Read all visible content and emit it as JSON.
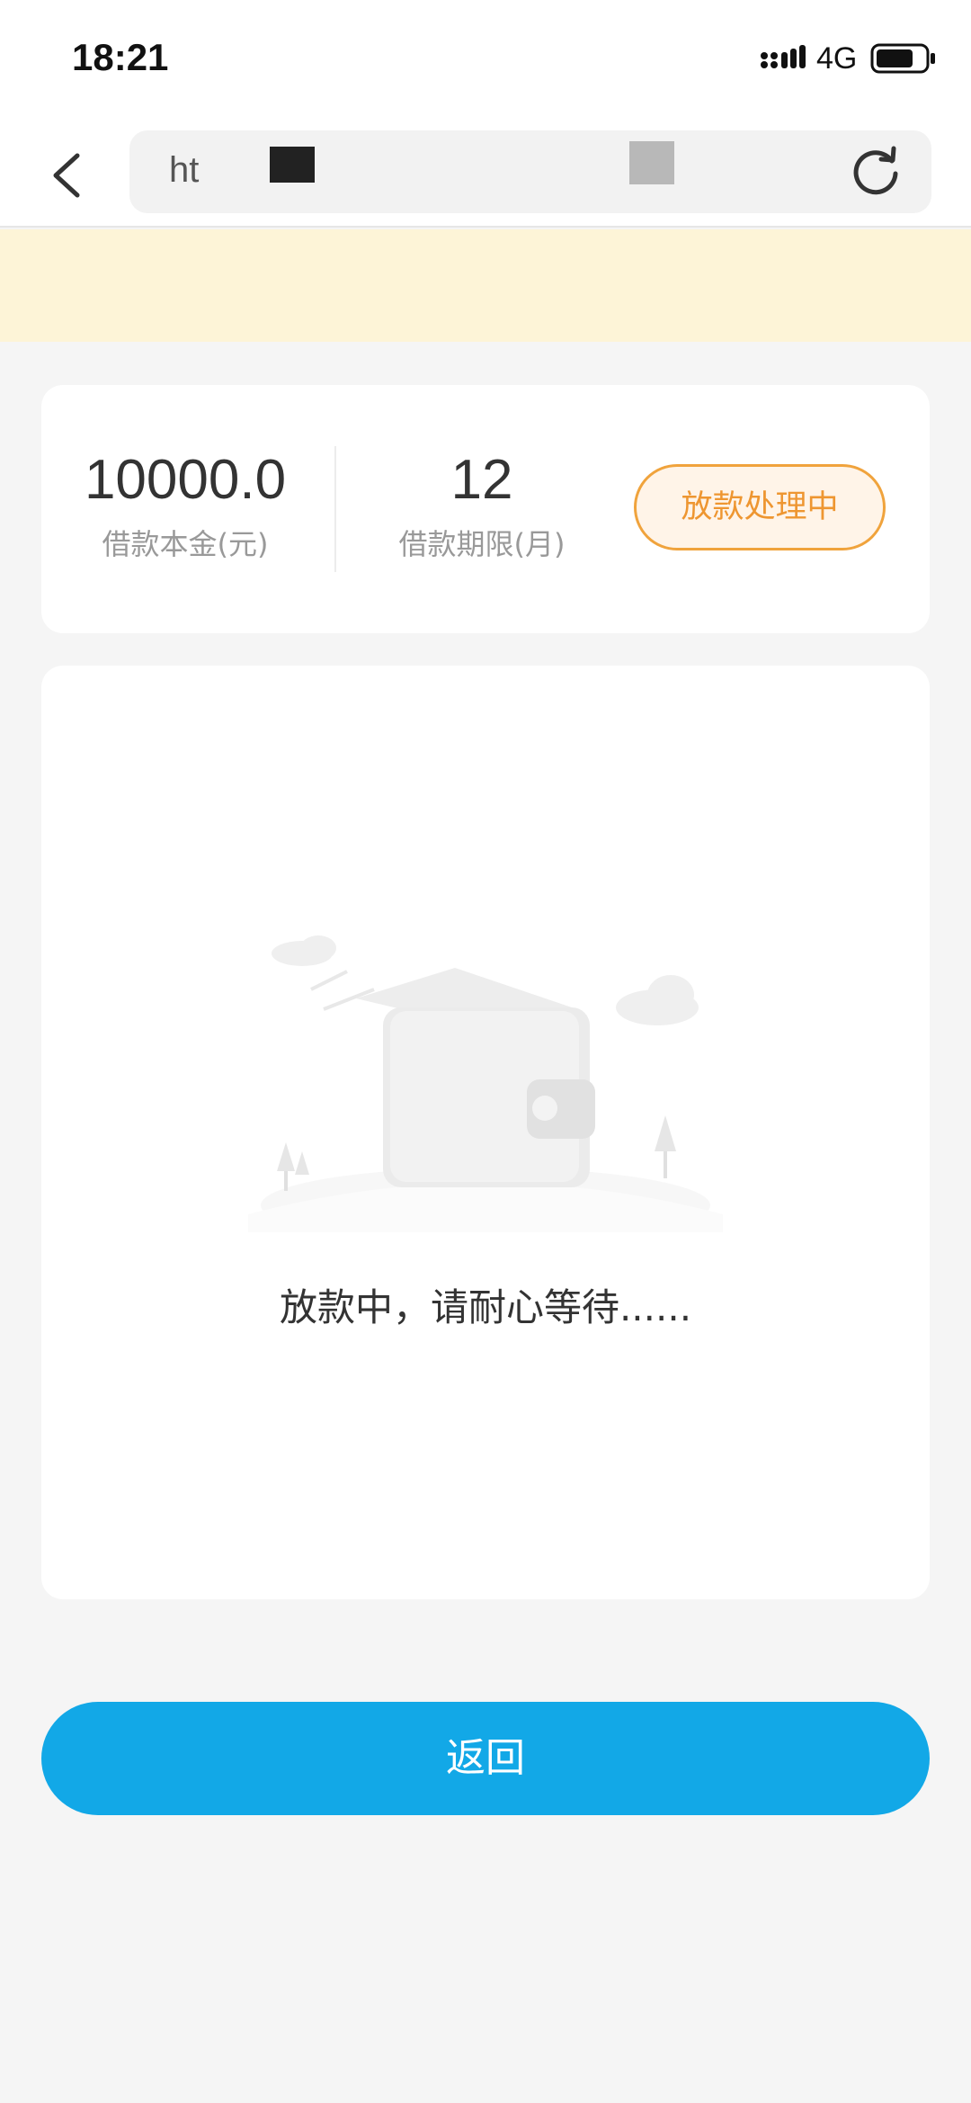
{
  "status_bar": {
    "time": "18:21",
    "network": "4G"
  },
  "browser_bar": {
    "url_text": "ht"
  },
  "summary": {
    "amount_value": "10000.0",
    "amount_label": "借款本金(元)",
    "term_value": "12",
    "term_label": "借款期限(月)",
    "status_badge": "放款处理中"
  },
  "main": {
    "waiting_message": "放款中，请耐心等待......"
  },
  "actions": {
    "return_label": "返回"
  },
  "colors": {
    "primary": "#12a8e7",
    "badge": "#ee9631",
    "notice_bg": "#fdf4d7"
  },
  "icons": [
    "back-icon",
    "refresh-icon",
    "signal-icon",
    "battery-icon",
    "wallet-illustration"
  ]
}
